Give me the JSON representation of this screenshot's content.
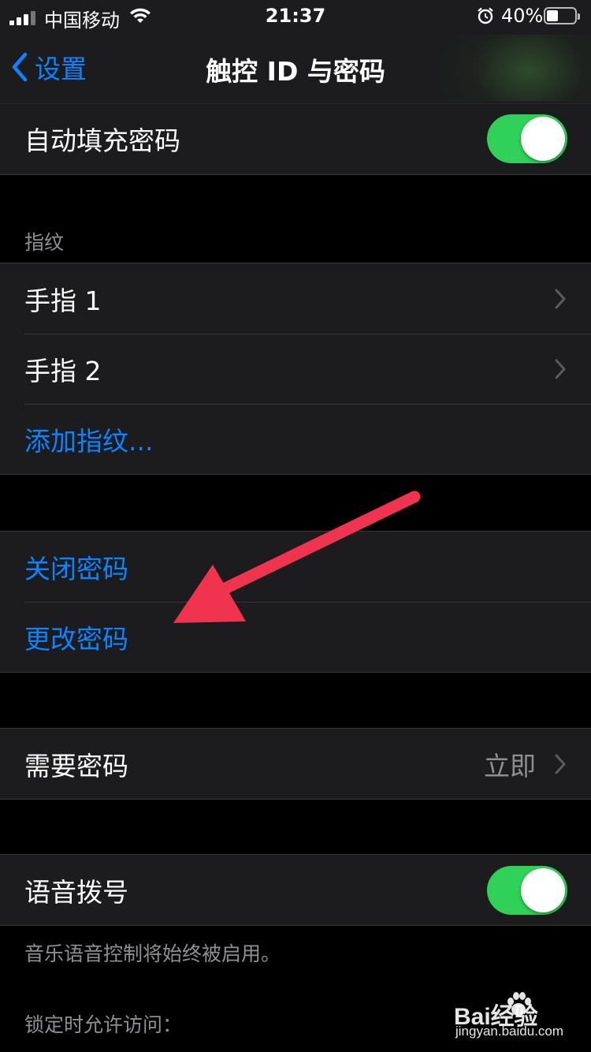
{
  "status_bar": {
    "carrier": "中国移动",
    "time": "21:37",
    "battery_percent": "40%",
    "battery_level": 0.4
  },
  "nav": {
    "back_label": "设置",
    "title": "触控 ID 与密码"
  },
  "autofill": {
    "label": "自动填充密码",
    "on": true
  },
  "fingerprints": {
    "header": "指纹",
    "items": [
      {
        "label": "手指 1"
      },
      {
        "label": "手指 2"
      }
    ],
    "add_label": "添加指纹..."
  },
  "passcode": {
    "turn_off_label": "关闭密码",
    "change_label": "更改密码"
  },
  "require_passcode": {
    "label": "需要密码",
    "value": "立即"
  },
  "voice_dial": {
    "label": "语音拨号",
    "on": true,
    "footer": "音乐语音控制将始终被启用。"
  },
  "allow_access": {
    "header": "锁定时允许访问："
  },
  "annotation": {
    "arrow_color": "#f0344f"
  },
  "watermark": {
    "brand": "Bai经验",
    "url": "jingyan.baidu.com"
  },
  "colors": {
    "accent": "#0a84ff",
    "toggle_on": "#30d158",
    "background": "#000000",
    "cell": "#1c1c1e"
  }
}
